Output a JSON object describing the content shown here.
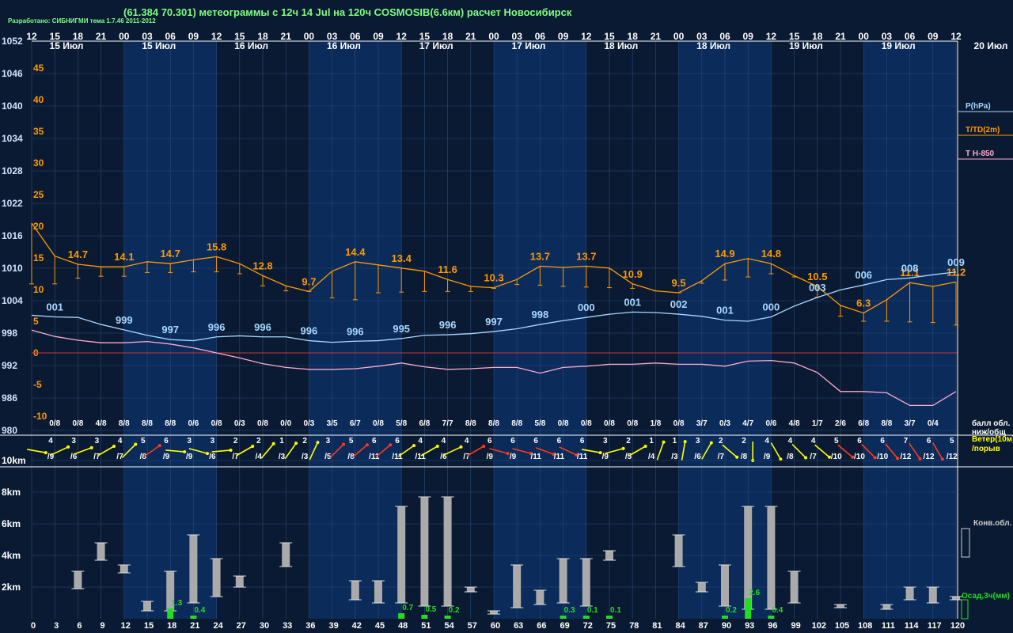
{
  "header": {
    "title": "(61.384 70.301) метеограммы с  12ч 14 Jul на 120ч COSMOSIB(6.6км) расчет Новосибирск",
    "developer": "Разработано: СИБНИГМИ тема 1.7.46 2011-2012"
  },
  "colors": {
    "background": "#0a1a33",
    "band_light": "#0d3a7a",
    "pressure": "#a8d8ff",
    "temperature": "#ff9a00",
    "t850": "#ffaacc",
    "zero_line": "#cc3333",
    "grid": "#2a4a7a",
    "wind_yellow": "#ffff00",
    "wind_red": "#ff3a1a",
    "precip": "#22dd22",
    "cloud": "#aaaaaa"
  },
  "top_hours": [
    "12",
    "15",
    "18",
    "21",
    "00",
    "03",
    "06",
    "09",
    "12",
    "15",
    "18",
    "21",
    "00",
    "03",
    "06",
    "09",
    "12",
    "15",
    "18",
    "21",
    "00",
    "03",
    "06",
    "09",
    "12",
    "15",
    "18",
    "21",
    "00",
    "03",
    "06",
    "09",
    "12",
    "15",
    "18",
    "21",
    "00",
    "03",
    "06",
    "09",
    "12",
    "15",
    "18",
    "21",
    "00",
    "03",
    "06",
    "09",
    "12",
    "15",
    "18",
    "21",
    "00",
    "03",
    "06",
    "09",
    "12",
    "15",
    "18",
    "21",
    "00",
    "03",
    "06",
    "09",
    "12"
  ],
  "day_labels": [
    {
      "text": "15 Июл",
      "col": 0
    },
    {
      "text": "15 Июл",
      "col": 4
    },
    {
      "text": "16 Июл",
      "col": 8
    },
    {
      "text": "16 Июл",
      "col": 12
    },
    {
      "text": "17 Июл",
      "col": 16
    },
    {
      "text": "17 Июл",
      "col": 20
    },
    {
      "text": "18 Июл",
      "col": 24
    },
    {
      "text": "18 Июл",
      "col": 28
    },
    {
      "text": "19 Июл",
      "col": 32
    },
    {
      "text": "19 Июл",
      "col": 36
    },
    {
      "text": "20 Июл",
      "col": 40
    }
  ],
  "pressure_axis": [
    "1052",
    "1046",
    "1040",
    "1034",
    "1028",
    "1022",
    "1016",
    "1010",
    "1004",
    "998",
    "992",
    "986",
    "980"
  ],
  "temp_axis": [
    "45",
    "40",
    "35",
    "30",
    "25",
    "20",
    "15",
    "10",
    "5",
    "0",
    "-5",
    "-10"
  ],
  "legend": {
    "pressure": "P(hPa)",
    "temperature": "T/TD(2m)",
    "t850": "T H-850",
    "cloud_cover": "балл обл.\nниж/общ",
    "wind": "Ветер(10м)\n/порыв",
    "convective": "Конв.обл.",
    "precip": "Осад,3ч(мм)"
  },
  "chart_data": {
    "type": "line",
    "x_hours": [
      0,
      3,
      6,
      9,
      12,
      15,
      18,
      21,
      24,
      27,
      30,
      33,
      36,
      39,
      42,
      45,
      48,
      51,
      54,
      57,
      60,
      63,
      66,
      69,
      72,
      75,
      78,
      81,
      84,
      87,
      90,
      93,
      96,
      99,
      102,
      105,
      108,
      111,
      114,
      117,
      120
    ],
    "pressure": [
      1001.3,
      1001,
      1000.9,
      999.6,
      998.6,
      997.6,
      996.8,
      996.6,
      997.3,
      997.5,
      997.3,
      997.3,
      996.6,
      996.3,
      996.5,
      996.6,
      997,
      997.6,
      997.7,
      997.9,
      998.3,
      998.8,
      999.6,
      1000.3,
      1000.9,
      1001.5,
      1001.9,
      1001.8,
      1001.5,
      1001.1,
      1000.4,
      1000.2,
      1001,
      1003,
      1004.6,
      1006,
      1006.9,
      1007.9,
      1008.2,
      1008.8,
      1009.3
    ],
    "pressure_labels": [
      {
        "col": 1,
        "text": "001"
      },
      {
        "col": 4,
        "text": "999"
      },
      {
        "col": 6,
        "text": "997"
      },
      {
        "col": 8,
        "text": "996"
      },
      {
        "col": 10,
        "text": "996"
      },
      {
        "col": 12,
        "text": "996"
      },
      {
        "col": 14,
        "text": "996"
      },
      {
        "col": 16,
        "text": "995"
      },
      {
        "col": 18,
        "text": "996"
      },
      {
        "col": 20,
        "text": "997"
      },
      {
        "col": 22,
        "text": "998"
      },
      {
        "col": 24,
        "text": "000"
      },
      {
        "col": 26,
        "text": "001"
      },
      {
        "col": 28,
        "text": "002"
      },
      {
        "col": 30,
        "text": "001"
      },
      {
        "col": 32,
        "text": "000"
      },
      {
        "col": 34,
        "text": "003"
      },
      {
        "col": 36,
        "text": "006"
      },
      {
        "col": 38,
        "text": "008"
      },
      {
        "col": 40,
        "text": "009"
      }
    ],
    "temperature": [
      20.5,
      15.3,
      14,
      13.6,
      13.6,
      14.4,
      14.1,
      14.7,
      15.2,
      14.1,
      12.2,
      10.6,
      9.7,
      12.9,
      14.4,
      13.9,
      13.4,
      12.9,
      11.6,
      10.5,
      10.3,
      11.6,
      13.7,
      13.5,
      13.7,
      13.4,
      10.9,
      9.8,
      9.5,
      11.4,
      14.1,
      14.9,
      14.1,
      12.2,
      10.5,
      7.5,
      6.3,
      8.4,
      11.1,
      10.5,
      11.2
    ],
    "dewpoint": [
      10.9,
      10.9,
      11.8,
      12.1,
      12.1,
      12.7,
      12.7,
      12.8,
      12.8,
      12.5,
      10.6,
      9.8,
      9.7,
      8.7,
      8.4,
      9.5,
      9.6,
      9.7,
      9.7,
      9.7,
      10.2,
      10.8,
      10.7,
      10.5,
      10.4,
      10.3,
      10.2,
      9.8,
      9.5,
      11.0,
      11.5,
      12.0,
      12.5,
      12.0,
      8.8,
      5.8,
      5.0,
      5.0,
      4.9,
      4.8,
      4.4
    ],
    "temp_labels": [
      {
        "col": 2,
        "text": "14.7"
      },
      {
        "col": 4,
        "text": "14.1"
      },
      {
        "col": 6,
        "text": "14.7"
      },
      {
        "col": 8,
        "text": "15.8"
      },
      {
        "col": 10,
        "text": "12.8"
      },
      {
        "col": 12,
        "text": "9.7"
      },
      {
        "col": 14,
        "text": "14.4"
      },
      {
        "col": 16,
        "text": "13.4"
      },
      {
        "col": 18,
        "text": "11.6"
      },
      {
        "col": 20,
        "text": "10.3"
      },
      {
        "col": 22,
        "text": "13.7"
      },
      {
        "col": 24,
        "text": "13.7"
      },
      {
        "col": 26,
        "text": "10.9"
      },
      {
        "col": 28,
        "text": "9.5"
      },
      {
        "col": 30,
        "text": "14.9"
      },
      {
        "col": 32,
        "text": "14.8"
      },
      {
        "col": 34,
        "text": "10.5"
      },
      {
        "col": 36,
        "text": "6.3"
      },
      {
        "col": 38,
        "text": "11.1"
      },
      {
        "col": 40,
        "text": "11.2"
      }
    ],
    "t850": [
      3.6,
      2.6,
      2,
      1.6,
      1.6,
      1.8,
      1.4,
      0.8,
      0,
      -0.8,
      -1.7,
      -2.3,
      -2.6,
      -2.6,
      -2.5,
      -2.1,
      -1.6,
      -2.2,
      -2.6,
      -2.5,
      -2.3,
      -2.3,
      -3.2,
      -2.3,
      -2.1,
      -1.8,
      -1.8,
      -1.6,
      -1.8,
      -1.8,
      -2.1,
      -1.3,
      -1.2,
      -1.6,
      -3.1,
      -6.1,
      -6.1,
      -6.3,
      -8.3,
      -8.3,
      -6.1
    ],
    "cloud_cover": [
      "0/8",
      "0/8",
      "4/8",
      "8/8",
      "8/8",
      "8/8",
      "0/6",
      "0/8",
      "0/3",
      "0/8",
      "0/0",
      "0/3",
      "3/5",
      "6/7",
      "0/8",
      "5/8",
      "6/8",
      "7/7",
      "8/8",
      "8/8",
      "8/8",
      "5/8",
      "0/8",
      "0/8",
      "0/8",
      "0/8",
      "1/8",
      "0/8",
      "3/7",
      "0/3",
      "4/7",
      "0/6",
      "4/8",
      "1/7",
      "2/6",
      "6/8",
      "8/8",
      "3/7",
      "0/4"
    ],
    "wind": [
      {
        "s": "4",
        "g": "/9",
        "dir": 10,
        "c": "y"
      },
      {
        "s": "3",
        "g": "/6",
        "dir": -25,
        "c": "y"
      },
      {
        "s": "3",
        "g": "/7",
        "dir": -20,
        "c": "y"
      },
      {
        "s": "4",
        "g": "/7",
        "dir": -30,
        "c": "y"
      },
      {
        "s": "5",
        "g": "/8",
        "dir": -45,
        "c": "y"
      },
      {
        "s": "6",
        "g": "/9",
        "dir": -35,
        "c": "r"
      },
      {
        "s": "3",
        "g": "/9",
        "dir": 5,
        "c": "y"
      },
      {
        "s": "3",
        "g": "/6",
        "dir": 15,
        "c": "y"
      },
      {
        "s": "2",
        "g": "/7",
        "dir": -5,
        "c": "y"
      },
      {
        "s": "2",
        "g": "/4",
        "dir": -30,
        "c": "y"
      },
      {
        "s": "1",
        "g": "/3",
        "dir": -50,
        "c": "y"
      },
      {
        "s": "2",
        "g": "/3",
        "dir": -55,
        "c": "y"
      },
      {
        "s": "3",
        "g": "/5",
        "dir": -65,
        "c": "y"
      },
      {
        "s": "5",
        "g": "/8",
        "dir": -45,
        "c": "r"
      },
      {
        "s": "6",
        "g": "/11",
        "dir": -40,
        "c": "r"
      },
      {
        "s": "6",
        "g": "/11",
        "dir": -40,
        "c": "r"
      },
      {
        "s": "4",
        "g": "/11",
        "dir": -35,
        "c": "y"
      },
      {
        "s": "4",
        "g": "/6",
        "dir": -30,
        "c": "y"
      },
      {
        "s": "4",
        "g": "/7",
        "dir": -25,
        "c": "y"
      },
      {
        "s": "6",
        "g": "/9",
        "dir": -30,
        "c": "r"
      },
      {
        "s": "6",
        "g": "/9",
        "dir": 15,
        "c": "r"
      },
      {
        "s": "6",
        "g": "/11",
        "dir": 15,
        "c": "r"
      },
      {
        "s": "6",
        "g": "/11",
        "dir": 20,
        "c": "r"
      },
      {
        "s": "6",
        "g": "/11",
        "dir": 25,
        "c": "r"
      },
      {
        "s": "3",
        "g": "/9",
        "dir": 10,
        "c": "y"
      },
      {
        "s": "2",
        "g": "/5",
        "dir": -15,
        "c": "y"
      },
      {
        "s": "1",
        "g": "/4",
        "dir": -30,
        "c": "y"
      },
      {
        "s": "1",
        "g": "/3",
        "dir": -70,
        "c": "y"
      },
      {
        "s": "3",
        "g": "/6",
        "dir": -80,
        "c": "y"
      },
      {
        "s": "2",
        "g": "/7",
        "dir": -60,
        "c": "y"
      },
      {
        "s": "2",
        "g": "/8",
        "dir": 40,
        "c": "y"
      },
      {
        "s": "4",
        "g": "/9",
        "dir": 90,
        "c": "y"
      },
      {
        "s": "4",
        "g": "/8",
        "dir": 60,
        "c": "y"
      },
      {
        "s": "4",
        "g": "/7",
        "dir": 45,
        "c": "y"
      },
      {
        "s": "5",
        "g": "/10",
        "dir": 40,
        "c": "y"
      },
      {
        "s": "6",
        "g": "/10",
        "dir": 40,
        "c": "r"
      },
      {
        "s": "6",
        "g": "/10",
        "dir": 45,
        "c": "r"
      },
      {
        "s": "7",
        "g": "/12",
        "dir": 50,
        "c": "r"
      },
      {
        "s": "6",
        "g": "/12",
        "dir": 55,
        "c": "r"
      },
      {
        "s": "5",
        "g": "/12",
        "dir": 60,
        "c": "r"
      }
    ],
    "height_axis": [
      "10km",
      "8km",
      "6km",
      "4km",
      "2km"
    ],
    "convective_cloud": [
      {
        "h": 6,
        "b": 1.9,
        "t": 3.0
      },
      {
        "h": 9,
        "b": 3.7,
        "t": 4.8
      },
      {
        "h": 12,
        "b": 2.9,
        "t": 3.4
      },
      {
        "h": 15,
        "b": 0.5,
        "t": 1.1
      },
      {
        "h": 18,
        "b": 0.5,
        "t": 3.0
      },
      {
        "h": 21,
        "b": 1.0,
        "t": 5.3
      },
      {
        "h": 24,
        "b": 1.4,
        "t": 3.8
      },
      {
        "h": 27,
        "b": 2.0,
        "t": 2.7
      },
      {
        "h": 33,
        "b": 3.3,
        "t": 4.8
      },
      {
        "h": 42,
        "b": 1.2,
        "t": 2.4
      },
      {
        "h": 45,
        "b": 1.0,
        "t": 2.4
      },
      {
        "h": 48,
        "b": 1.0,
        "t": 7.1
      },
      {
        "h": 51,
        "b": 0.8,
        "t": 7.7
      },
      {
        "h": 54,
        "b": 0.8,
        "t": 7.7
      },
      {
        "h": 57,
        "b": 1.7,
        "t": 2.0
      },
      {
        "h": 60,
        "b": 0.3,
        "t": 0.5
      },
      {
        "h": 63,
        "b": 0.7,
        "t": 3.4
      },
      {
        "h": 66,
        "b": 0.9,
        "t": 1.8
      },
      {
        "h": 69,
        "b": 1.0,
        "t": 3.8
      },
      {
        "h": 72,
        "b": 0.8,
        "t": 3.8
      },
      {
        "h": 75,
        "b": 3.7,
        "t": 4.3
      },
      {
        "h": 84,
        "b": 3.3,
        "t": 5.3
      },
      {
        "h": 87,
        "b": 1.7,
        "t": 2.3
      },
      {
        "h": 90,
        "b": 0.8,
        "t": 3.4
      },
      {
        "h": 93,
        "b": 0.6,
        "t": 7.1
      },
      {
        "h": 96,
        "b": 0.6,
        "t": 7.1
      },
      {
        "h": 99,
        "b": 1.0,
        "t": 3.0
      },
      {
        "h": 105,
        "b": 0.7,
        "t": 0.9
      },
      {
        "h": 111,
        "b": 0.6,
        "t": 0.9
      },
      {
        "h": 114,
        "b": 1.2,
        "t": 2.0
      },
      {
        "h": 117,
        "b": 1.0,
        "t": 2.0
      },
      {
        "h": 120,
        "b": 1.2,
        "t": 1.4
      }
    ],
    "precip": [
      {
        "h": 18,
        "v": 1.3,
        "label": "1.3"
      },
      {
        "h": 21,
        "v": 0.4,
        "label": "0.4"
      },
      {
        "h": 48,
        "v": 0.7,
        "label": "0.7"
      },
      {
        "h": 51,
        "v": 0.5,
        "label": "0.5"
      },
      {
        "h": 54,
        "v": 0.2,
        "label": "0.2"
      },
      {
        "h": 69,
        "v": 0.3,
        "label": "0.3"
      },
      {
        "h": 72,
        "v": 0.1,
        "label": "0.1"
      },
      {
        "h": 75,
        "v": 0.1,
        "label": "0.1"
      },
      {
        "h": 90,
        "v": 0.2,
        "label": "0.2"
      },
      {
        "h": 93,
        "v": 2.6,
        "label": "2.6"
      },
      {
        "h": 96,
        "v": 0.4,
        "label": "0.4"
      }
    ],
    "bottom_axis": [
      "0",
      "3",
      "6",
      "9",
      "12",
      "15",
      "18",
      "21",
      "24",
      "27",
      "30",
      "33",
      "36",
      "39",
      "42",
      "45",
      "48",
      "51",
      "54",
      "57",
      "60",
      "63",
      "66",
      "69",
      "72",
      "75",
      "78",
      "81",
      "84",
      "87",
      "90",
      "93",
      "96",
      "99",
      "102",
      "105",
      "108",
      "111",
      "114",
      "117",
      "120"
    ],
    "plim": [
      980,
      1052
    ],
    "tlim": [
      -10,
      45
    ]
  }
}
